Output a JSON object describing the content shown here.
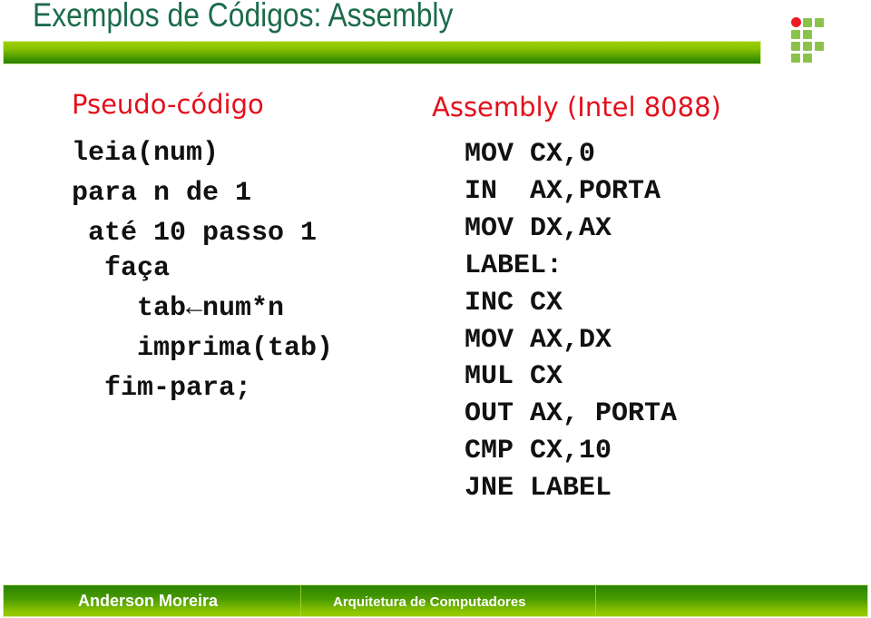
{
  "slide": {
    "title": "Exemplos de Códigos: Assembly"
  },
  "logo": {
    "name": "IF institute logo",
    "accent_red": "#ee1c24",
    "accent_green": "#8bc34a"
  },
  "left_panel": {
    "heading": "Pseudo-código",
    "lines": [
      "leia(num)",
      "para n de 1",
      " até 10 passo 1",
      "  faça",
      "    tab←num*n",
      "    imprima(tab)",
      "  fim-para;"
    ]
  },
  "right_panel": {
    "heading": "Assembly (Intel 8088)",
    "lines": [
      "MOV CX,0",
      "IN  AX,PORTA",
      "MOV DX,AX",
      "LABEL:",
      "INC CX",
      "MOV AX,DX",
      "MUL CX",
      "OUT AX, PORTA",
      "CMP CX,10",
      "JNE LABEL"
    ]
  },
  "footer": {
    "author": "Anderson Moreira",
    "course": "Arquitetura de Computadores",
    "extra": ""
  },
  "colors": {
    "title": "#1b6b4b",
    "heading": "#e3101c",
    "bar_light": "#9acc00",
    "bar_dark": "#2a8200"
  }
}
